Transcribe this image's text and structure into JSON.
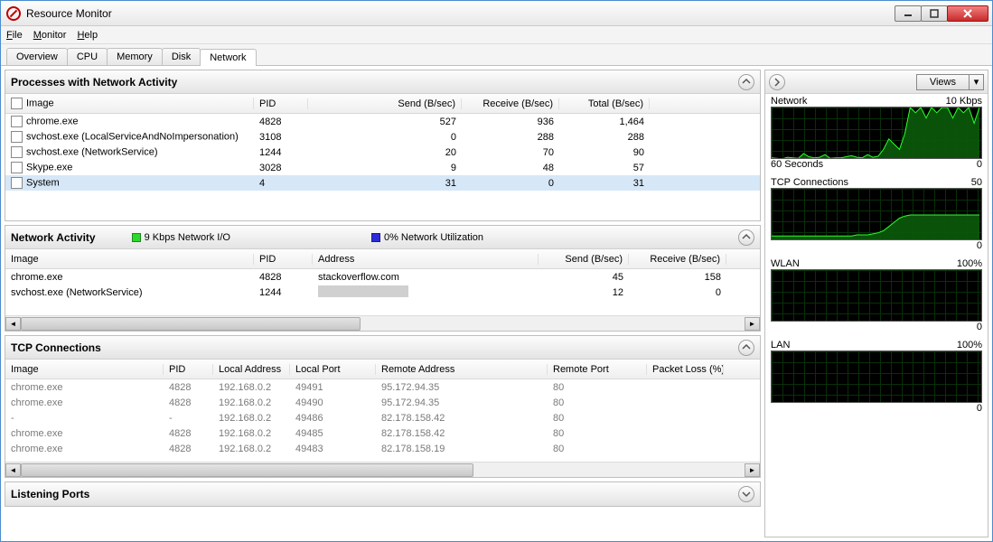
{
  "window": {
    "title": "Resource Monitor"
  },
  "menus": [
    "File",
    "Monitor",
    "Help"
  ],
  "tabs": [
    "Overview",
    "CPU",
    "Memory",
    "Disk",
    "Network"
  ],
  "active_tab": 4,
  "panels": {
    "processes": {
      "title": "Processes with Network Activity",
      "cols": [
        "Image",
        "PID",
        "Send (B/sec)",
        "Receive (B/sec)",
        "Total (B/sec)"
      ],
      "rows": [
        {
          "image": "chrome.exe",
          "pid": "4828",
          "send": "527",
          "recv": "936",
          "total": "1,464"
        },
        {
          "image": "svchost.exe (LocalServiceAndNoImpersonation)",
          "pid": "3108",
          "send": "0",
          "recv": "288",
          "total": "288"
        },
        {
          "image": "svchost.exe (NetworkService)",
          "pid": "1244",
          "send": "20",
          "recv": "70",
          "total": "90"
        },
        {
          "image": "Skype.exe",
          "pid": "3028",
          "send": "9",
          "recv": "48",
          "total": "57"
        },
        {
          "image": "System",
          "pid": "4",
          "send": "31",
          "recv": "0",
          "total": "31"
        }
      ]
    },
    "activity": {
      "title": "Network Activity",
      "legend1": "9 Kbps Network I/O",
      "legend2": "0% Network Utilization",
      "cols": [
        "Image",
        "PID",
        "Address",
        "Send (B/sec)",
        "Receive (B/sec)"
      ],
      "rows": [
        {
          "image": "chrome.exe",
          "pid": "4828",
          "addr": "stackoverflow.com",
          "send": "45",
          "recv": "158"
        },
        {
          "image": "svchost.exe (NetworkService)",
          "pid": "1244",
          "addr": "",
          "send": "12",
          "recv": "0"
        }
      ]
    },
    "tcp": {
      "title": "TCP Connections",
      "cols": [
        "Image",
        "PID",
        "Local Address",
        "Local Port",
        "Remote Address",
        "Remote Port",
        "Packet Loss (%)"
      ],
      "rows": [
        {
          "image": "chrome.exe",
          "pid": "4828",
          "laddr": "192.168.0.2",
          "lport": "49491",
          "raddr": "95.172.94.35",
          "rport": "80",
          "loss": ""
        },
        {
          "image": "chrome.exe",
          "pid": "4828",
          "laddr": "192.168.0.2",
          "lport": "49490",
          "raddr": "95.172.94.35",
          "rport": "80",
          "loss": ""
        },
        {
          "image": "-",
          "pid": "-",
          "laddr": "192.168.0.2",
          "lport": "49486",
          "raddr": "82.178.158.42",
          "rport": "80",
          "loss": ""
        },
        {
          "image": "chrome.exe",
          "pid": "4828",
          "laddr": "192.168.0.2",
          "lport": "49485",
          "raddr": "82.178.158.42",
          "rport": "80",
          "loss": ""
        },
        {
          "image": "chrome.exe",
          "pid": "4828",
          "laddr": "192.168.0.2",
          "lport": "49483",
          "raddr": "82.178.158.19",
          "rport": "80",
          "loss": ""
        }
      ]
    },
    "listening": {
      "title": "Listening Ports"
    }
  },
  "side": {
    "views_label": "Views",
    "charts": [
      {
        "name": "Network",
        "max": "10 Kbps",
        "bottom_left": "60 Seconds",
        "bottom_right": "0"
      },
      {
        "name": "TCP Connections",
        "max": "50",
        "bottom_left": "",
        "bottom_right": "0"
      },
      {
        "name": "WLAN",
        "max": "100%",
        "bottom_left": "",
        "bottom_right": "0"
      },
      {
        "name": "LAN",
        "max": "100%",
        "bottom_left": "",
        "bottom_right": "0"
      }
    ]
  },
  "chart_data": [
    {
      "type": "area",
      "title": "Network",
      "ylim": [
        0,
        10
      ],
      "yunit": "Kbps",
      "x_seconds": 60,
      "series": [
        {
          "name": "usage",
          "values_est": [
            0.4,
            0.3,
            0.2,
            0.5,
            0.4,
            0.3,
            1.2,
            0.6,
            0.4,
            0.5,
            1.0,
            0.3,
            0.4,
            0.4,
            0.6,
            0.8,
            0.5,
            0.4,
            1.0,
            0.5,
            0.7,
            2.0,
            4.0,
            3.0,
            2.0,
            5.0,
            10,
            9,
            10,
            8,
            10,
            9,
            10,
            10,
            8,
            10,
            9,
            10,
            7,
            10
          ]
        }
      ]
    },
    {
      "type": "area",
      "title": "TCP Connections",
      "ylim": [
        0,
        50
      ],
      "x_seconds": 60,
      "series": [
        {
          "name": "connections",
          "values_est": [
            5,
            5,
            5,
            5,
            5,
            5,
            5,
            5,
            5,
            5,
            5,
            5,
            5,
            5,
            5,
            5,
            6,
            6,
            6,
            7,
            8,
            10,
            14,
            18,
            22,
            24,
            25,
            25,
            25,
            25,
            25,
            25,
            25,
            25,
            25,
            25,
            25,
            25,
            25,
            25
          ]
        }
      ]
    },
    {
      "type": "area",
      "title": "WLAN",
      "ylim": [
        0,
        100
      ],
      "yunit": "%",
      "x_seconds": 60,
      "series": [
        {
          "name": "utilization",
          "values_est": [
            0,
            0,
            0,
            0,
            0,
            0,
            0,
            0,
            0,
            0,
            0,
            0,
            0,
            0,
            0,
            0,
            0,
            0,
            0,
            0,
            0,
            0,
            0,
            0,
            0,
            0,
            0,
            0,
            0,
            0,
            0,
            0,
            0,
            0,
            0,
            0,
            0,
            0,
            0,
            0
          ]
        }
      ]
    },
    {
      "type": "area",
      "title": "LAN",
      "ylim": [
        0,
        100
      ],
      "yunit": "%",
      "x_seconds": 60,
      "series": [
        {
          "name": "utilization",
          "values_est": [
            0,
            0,
            0,
            0,
            0,
            0,
            0,
            0,
            0,
            0,
            0,
            0,
            0,
            0,
            0,
            0,
            0,
            0,
            0,
            0,
            0,
            0,
            0,
            0,
            0,
            0,
            0,
            0,
            0,
            0,
            0,
            0,
            0,
            0,
            0,
            0,
            0,
            0,
            0,
            0
          ]
        }
      ]
    }
  ]
}
